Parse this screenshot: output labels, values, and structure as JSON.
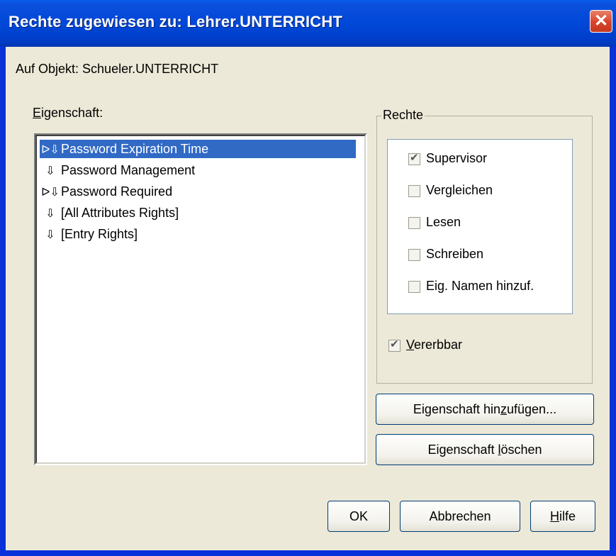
{
  "window": {
    "title": "Rechte zugewiesen zu: Lehrer.UNTERRICHT",
    "close_glyph": "✕"
  },
  "object_label": "Auf Objekt: Schueler.UNTERRICHT",
  "property": {
    "label_first": "E",
    "label_rest": "igenschaft:",
    "items": [
      {
        "icon": "inherit-arrow-icon",
        "glyph": "ᐅ⇩",
        "label": "Password Expiration Time",
        "selected": true
      },
      {
        "icon": "down-arrow-icon",
        "glyph": "⇩",
        "label": "Password Management",
        "selected": false
      },
      {
        "icon": "inherit-arrow-icon",
        "glyph": "ᐅ⇩",
        "label": "Password Required",
        "selected": false
      },
      {
        "icon": "down-arrow-icon",
        "glyph": "⇩",
        "label": "[All Attributes Rights]",
        "selected": false
      },
      {
        "icon": "down-arrow-icon",
        "glyph": "⇩",
        "label": "[Entry Rights]",
        "selected": false
      }
    ]
  },
  "rights": {
    "title": "Rechte",
    "items": [
      {
        "label": "Supervisor",
        "checked": true
      },
      {
        "label": "Vergleichen",
        "checked": false
      },
      {
        "label": "Lesen",
        "checked": false
      },
      {
        "label": "Schreiben",
        "checked": false
      },
      {
        "label": "Eig. Namen hinzuf.",
        "checked": false
      }
    ],
    "inheritable": {
      "label_first": "V",
      "label_rest": "ererbbar",
      "checked": true
    }
  },
  "buttons": {
    "add_property": {
      "before": "Eigenschaft hin",
      "accel": "z",
      "after": "ufügen..."
    },
    "delete_property": {
      "before": "Eigenschaft ",
      "accel": "l",
      "after": "öschen"
    },
    "ok": "OK",
    "cancel": "Abbrechen",
    "help": {
      "accel": "H",
      "after": "ilfe"
    }
  }
}
